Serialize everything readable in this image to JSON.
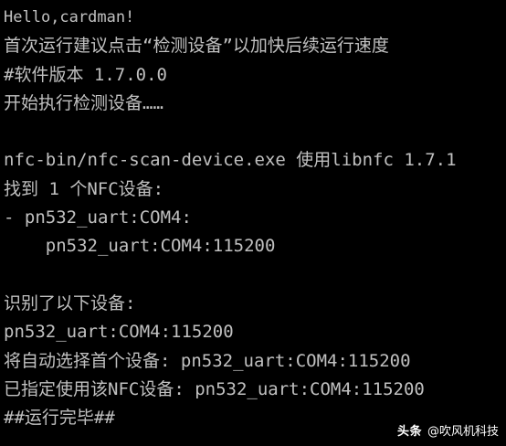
{
  "console": {
    "lines": [
      "Hello,cardman!",
      "首次运行建议点击“检测设备”以加快后续运行速度",
      "#软件版本 1.7.0.0",
      "开始执行检测设备……",
      "",
      "nfc-bin/nfc-scan-device.exe 使用libnfc 1.7.1",
      "找到 1 个NFC设备:",
      "- pn532_uart:COM4:",
      "    pn532_uart:COM4:115200",
      "",
      "识别了以下设备:",
      "pn532_uart:COM4:115200",
      "将自动选择首个设备: pn532_uart:COM4:115200",
      "已指定使用该NFC设备: pn532_uart:COM4:115200",
      "##运行完毕##"
    ]
  },
  "watermark": {
    "logo": "头条",
    "author": "@吹风机科技"
  },
  "colors": {
    "background": "#000000",
    "text": "#c0c0c0"
  }
}
